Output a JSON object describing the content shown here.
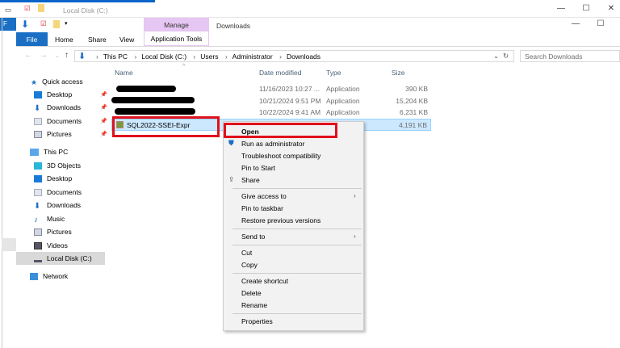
{
  "back_window": {
    "title": "Local Disk (C:)",
    "file_tab": "F"
  },
  "window": {
    "tabs": {
      "file": "File",
      "home": "Home",
      "share": "Share",
      "view": "View",
      "manage": "Manage",
      "app_tools": "Application Tools"
    },
    "title": "Downloads",
    "minimize": "—",
    "maximize": "☐",
    "close": "✕"
  },
  "address": {
    "crumbs": [
      "This PC",
      "Local Disk (C:)",
      "Users",
      "Administrator",
      "Downloads"
    ],
    "search_placeholder": "Search Downloads"
  },
  "nav": {
    "quick_access": "Quick access",
    "quick": [
      "Desktop",
      "Downloads",
      "Documents",
      "Pictures"
    ],
    "this_pc": "This PC",
    "pc": [
      "3D Objects",
      "Desktop",
      "Documents",
      "Downloads",
      "Music",
      "Pictures",
      "Videos",
      "Local Disk (C:)"
    ],
    "network": "Network"
  },
  "columns": {
    "name": "Name",
    "date": "Date modified",
    "type": "Type",
    "size": "Size"
  },
  "files": [
    {
      "name": "",
      "date": "11/16/2023 10:27 ...",
      "type": "Application",
      "size": "390 KB"
    },
    {
      "name": "",
      "date": "10/21/2024 9:51 PM",
      "type": "Application",
      "size": "15,204 KB"
    },
    {
      "name": "",
      "date": "10/22/2024 9:41 AM",
      "type": "Application",
      "size": "6,231 KB"
    },
    {
      "name": "SQL2022-SSEI-Expr",
      "date": "",
      "type": "",
      "size": "4,191 KB"
    }
  ],
  "context_menu": {
    "open": "Open",
    "run_admin": "Run as administrator",
    "troubleshoot": "Troubleshoot compatibility",
    "pin_start": "Pin to Start",
    "share": "Share",
    "give_access": "Give access to",
    "pin_taskbar": "Pin to taskbar",
    "restore": "Restore previous versions",
    "send_to": "Send to",
    "cut": "Cut",
    "copy": "Copy",
    "create_shortcut": "Create shortcut",
    "delete": "Delete",
    "rename": "Rename",
    "properties": "Properties"
  },
  "colors": {
    "accent": "#1a6fc4",
    "highlight": "#e0101c",
    "selection": "#cce8ff",
    "manage": "#e6c6f2"
  }
}
